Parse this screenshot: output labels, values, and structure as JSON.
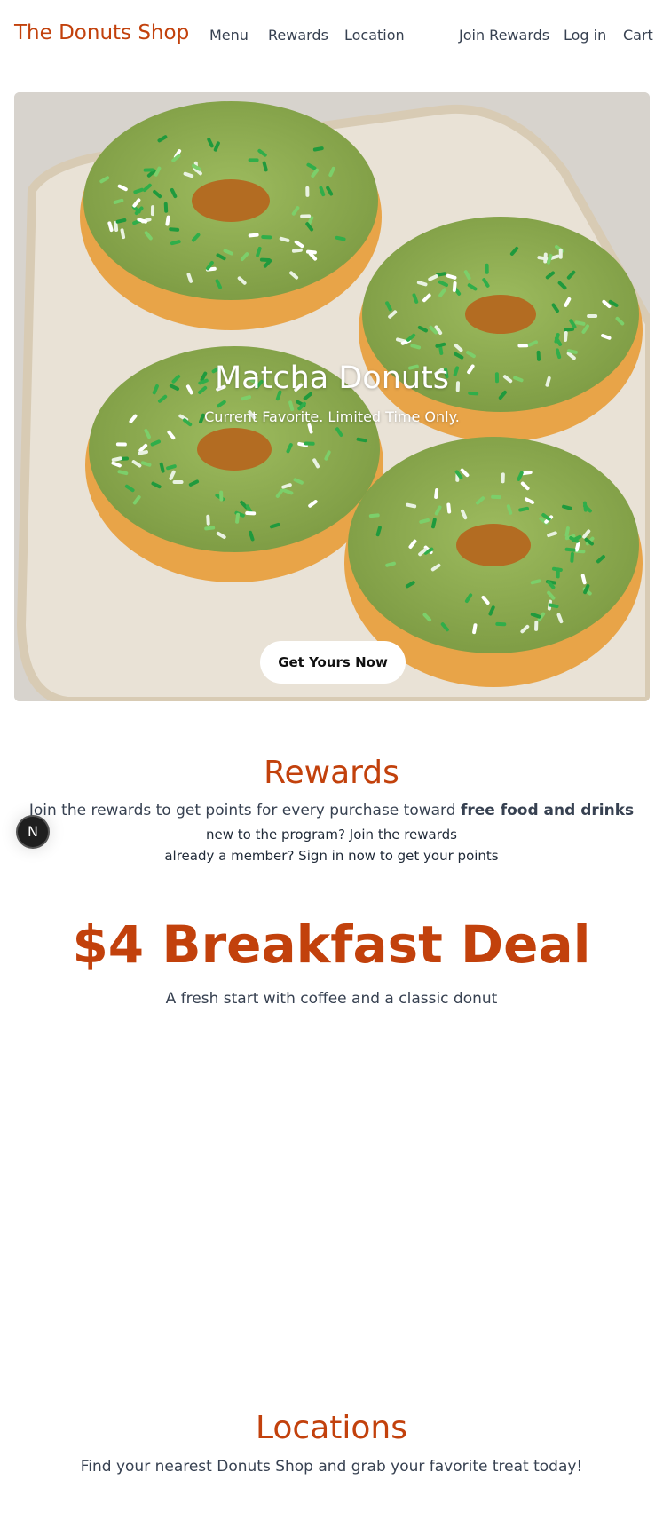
{
  "nav": {
    "brand": "The Donuts Shop",
    "links": [
      "Menu",
      "Rewards",
      "Location"
    ],
    "right_links": [
      "Join Rewards",
      "Log in",
      "Cart"
    ]
  },
  "hero": {
    "title": "Matcha Donuts",
    "subtitle": "Current Favorite. Limited Time Only.",
    "button": "Get Yours Now"
  },
  "rewards": {
    "title": "Rewards",
    "text_lead": "Join the rewards to get points for every purchase toward ",
    "text_bold": "free food and drinks",
    "line2": "new to the program? Join the rewards",
    "line3": "already a member? Sign in now to get your points"
  },
  "deal": {
    "title": "$4 Breakfast Deal",
    "subtitle": "A fresh start with coffee and a classic donut"
  },
  "locations": {
    "title": "Locations",
    "subtitle": "Find your nearest Donuts Shop and grab your favorite treat today!"
  },
  "badge": {
    "letter": "N"
  },
  "colors": {
    "accent": "#c2410c",
    "text": "#374151",
    "glaze": "#8fae52",
    "dough": "#e8a448"
  },
  "icons": {
    "badge": "next-logo-icon"
  }
}
